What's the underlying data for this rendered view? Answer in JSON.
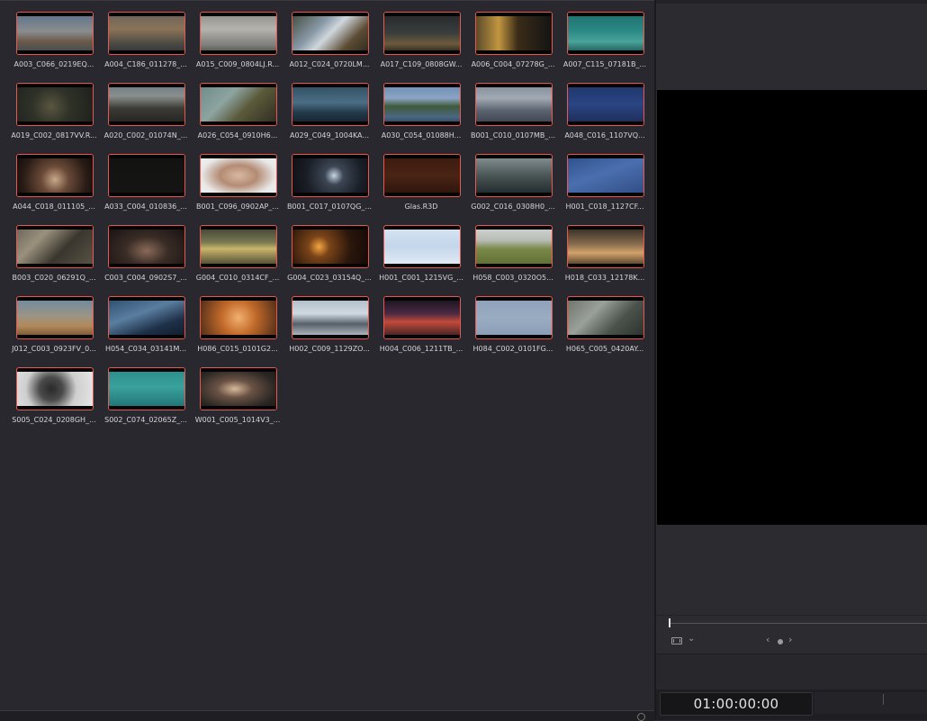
{
  "media_pool": {
    "clips": [
      {
        "name": "A003_C066_0219EQ...",
        "thumb": "linear-gradient(180deg,#5a6f8a 0%,#8a8d8e 45%,#6b5a49 70%,#3b4a55 100%)"
      },
      {
        "name": "A004_C186_011278_...",
        "thumb": "linear-gradient(180deg,#6b625a 0%,#8a7358 40%,#4c4a44 75%,#2d3236 100%)"
      },
      {
        "name": "A015_C009_0804LJ.R...",
        "thumb": "linear-gradient(180deg,#8d8d88 0%,#b4b3ae 40%,#7b7b77 80%,#4a4a48 100%)"
      },
      {
        "name": "A012_C024_0720LM...",
        "thumb": "linear-gradient(135deg,#3f4a3a 0%,#8a9aa8 35%,#d0d7dd 50%,#5a4a32 75%,#2c2a20 100%)"
      },
      {
        "name": "A017_C109_0808GW...",
        "thumb": "linear-gradient(180deg,#23272a 0%,#3a3f3d 50%,#6d5a3c 75%,#1b1d1e 100%)"
      },
      {
        "name": "A006_C004_07278G_...",
        "thumb": "linear-gradient(90deg,#5b4b2a 0%,#c29640 30%,#3a2c18 55%,#141414 100%)"
      },
      {
        "name": "A007_C115_07181B_...",
        "thumb": "linear-gradient(180deg,#1f6e6d 0%,#2b8a85 45%,#4aa39a 70%,#1b4d4f 100%)"
      },
      {
        "name": "A019_C002_0817VV.R...",
        "thumb": "radial-gradient(circle at 45% 55%,#5a5640 0%,#2f3228 40%,#1d201c 100%)"
      },
      {
        "name": "A020_C002_01074N_...",
        "thumb": "linear-gradient(180deg,#6a7b88 0%,#8a8f8c 30%,#3b3a34 60%,#22221f 100%)"
      },
      {
        "name": "A026_C054_0910H6...",
        "thumb": "linear-gradient(135deg,#6c8a8a 0%,#8da4a0 35%,#5a5a3a 60%,#2d2a20 100%)"
      },
      {
        "name": "A029_C049_1004KA...",
        "thumb": "linear-gradient(180deg,#2f4b5e 0%,#4b6e84 45%,#23394a 70%,#14202a 100%)"
      },
      {
        "name": "A030_C054_01088H...",
        "thumb": "linear-gradient(180deg,#6a8bb5 0%,#8aa4c3 35%,#3f5a3a 55%,#4a6784 80%,#2a3a4c 100%)"
      },
      {
        "name": "B001_C010_0107MB_...",
        "thumb": "linear-gradient(180deg,#7f8a99 0%,#a2a9b3 35%,#5b6370 65%,#3a404a 100%)"
      },
      {
        "name": "A048_C016_1107VQ...",
        "thumb": "linear-gradient(180deg,#1f3569 0%,#2a4584 50%,#1c2a52 100%)"
      },
      {
        "name": "A044_C018_011105_...",
        "thumb": "radial-gradient(circle at 50% 60%,#c9a88a 0%,#6a4a38 30%,#2a1c16 70%,#100c0a 100%)"
      },
      {
        "name": "A033_C004_010836_...",
        "thumb": "linear-gradient(180deg,#121212 0%,#161514 100%)"
      },
      {
        "name": "B001_C096_0902AP_...",
        "thumb": "radial-gradient(ellipse at 50% 50%,#d9b8a3 0%,#b48c74 35%,#e8e8e8 70%,#f2f2f2 100%)"
      },
      {
        "name": "B001_C017_0107QG_...",
        "thumb": "radial-gradient(circle at 55% 50%,#c7d3e0 0%,#3c4654 20%,#1a1e26 60%,#0d0f12 100%)"
      },
      {
        "name": "Glas.R3D",
        "thumb": "linear-gradient(180deg,#3a1a10 0%,#4a2414 50%,#2a140c 100%)"
      },
      {
        "name": "G002_C016_0308H0_...",
        "thumb": "linear-gradient(180deg,#8a9698 0%,#4a5556 50%,#1c2426 100%)"
      },
      {
        "name": "H001_C018_1127CF...",
        "thumb": "linear-gradient(160deg,#2c4f8a 0%,#4b6fae 45%,#2e4c84 100%)"
      },
      {
        "name": "B003_C020_06291Q_...",
        "thumb": "linear-gradient(135deg,#6a6458 0%,#9a917d 30%,#3a362e 60%,#5b5446 100%)"
      },
      {
        "name": "C003_C004_0902S7_...",
        "thumb": "radial-gradient(ellipse at 50% 60%,#8a6a58 0%,#3a2c26 40%,#141010 100%)"
      },
      {
        "name": "G004_C010_0314CF_...",
        "thumb": "linear-gradient(180deg,#3b3e34 0%,#7a7a52 40%,#c9b56a 55%,#3a3a2c 100%)"
      },
      {
        "name": "G004_C023_03154Q_...",
        "thumb": "radial-gradient(circle at 35% 50%,#f4a640 0%,#7a4418 20%,#2a160c 60%,#140a06 100%)"
      },
      {
        "name": "H001_C001_1215VG_...",
        "thumb": "linear-gradient(180deg,#d8e6f4 0%,#c4d6ea 50%,#e6eef6 100%)"
      },
      {
        "name": "H058_C003_0320O5...",
        "thumb": "linear-gradient(180deg,#d2d7d6 0%,#b8bcb4 35%,#7a8a4a 55%,#5c6a30 100%)"
      },
      {
        "name": "H018_C033_12178K...",
        "thumb": "linear-gradient(180deg,#2a2620 0%,#8a6e50 45%,#d2a26a 65%,#3a2e22 100%)"
      },
      {
        "name": "J012_C003_0923FV_0...",
        "thumb": "linear-gradient(180deg,#6a88a2 0%,#9a9486 45%,#b28a5a 70%,#6a4a2e 100%)"
      },
      {
        "name": "H054_C034_03141M...",
        "thumb": "linear-gradient(160deg,#2a4a6a 0%,#5a7ea0 40%,#1e3048 70%,#0e1a28 100%)"
      },
      {
        "name": "H086_C015_0101G2...",
        "thumb": "radial-gradient(circle at 50% 50%,#f2b070 0%,#c26a2a 40%,#4a2a18 100%)"
      },
      {
        "name": "H002_C009_1129ZO...",
        "thumb": "linear-gradient(180deg,#aab8c4 0%,#d0dae2 40%,#56606a 65%,#c8d0d6 100%)"
      },
      {
        "name": "H004_C006_1211TB_...",
        "thumb": "linear-gradient(180deg,#141018 0%,#4a2a44 40%,#c24a3a 60%,#2a1c22 100%)"
      },
      {
        "name": "H084_C002_0101FG...",
        "thumb": "linear-gradient(180deg,#8ea0b8 0%,#9aacc2 50%,#8a9cb4 100%)"
      },
      {
        "name": "H065_C005_0420AY...",
        "thumb": "linear-gradient(135deg,#6a7266 0%,#9aa09a 35%,#4a524a 65%,#2a302c 100%)"
      },
      {
        "name": "S005_C024_0208GH_...",
        "thumb": "radial-gradient(circle at 45% 50%,#2a2a2a 0%,#4a4a4a 25%,#cfcfcf 55%,#e8e8e8 100%)"
      },
      {
        "name": "S002_C074_02065Z_...",
        "thumb": "linear-gradient(180deg,#2a8a8a 0%,#3aa29c 45%,#1e6e70 100%)"
      },
      {
        "name": "W001_C005_1014V3_...",
        "thumb": "radial-gradient(ellipse at 45% 50%,#d8b89a 0%,#6a5244 30%,#2a2624 70%,#1a1816 100%)"
      }
    ]
  },
  "viewer": {
    "timecode": "01:00:00:00",
    "nav_prev": "‹",
    "nav_next": "›",
    "chevron": "⌄"
  }
}
